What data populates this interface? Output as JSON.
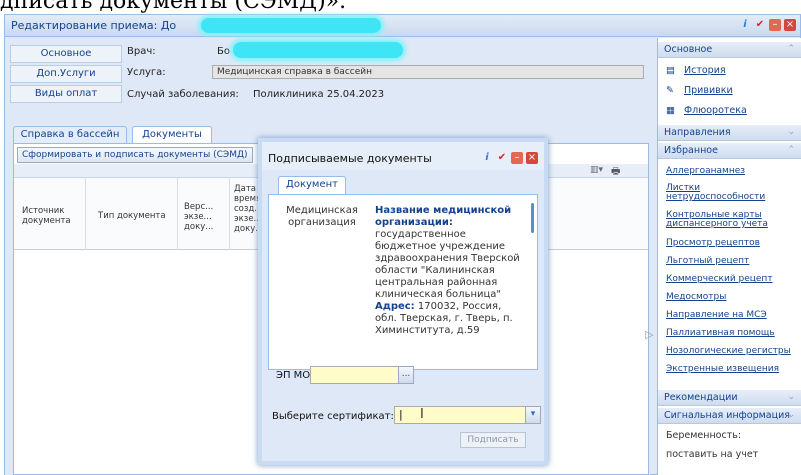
{
  "top_caption": "дписать документы (СЭМД)».",
  "window": {
    "title": "Редактирование приема: До"
  },
  "left_tabs": [
    "Основное",
    "Доп.Услуги",
    "Виды оплат"
  ],
  "form": {
    "doctor_label": "Врач:",
    "doctor_value": "Бо",
    "service_label": "Услуга:",
    "service_value": "Медицинская справка в бассейн",
    "case_label": "Случай заболевания:",
    "case_value": "Поликлиника 25.04.2023"
  },
  "sub_tabs": [
    "Справка в бассейн",
    "Документы"
  ],
  "toolbar": {
    "sign_button": "Сформировать и подписать документы (СЭМД)"
  },
  "grid_columns": [
    "Источник документа",
    "Тип документа",
    "Верс... экзе... доку...",
    "Дата и время созд... экзе... доку..."
  ],
  "dialog": {
    "title": "Подписываемые документы",
    "tab": "Документ",
    "org_label": "Медицинская организация",
    "org_name_label": "Название медицинской организации:",
    "org_name_value": "государственное бюджетное учреждение здравоохранения Тверской области \"Калининская центральная районная клиническая больница\"",
    "address_label": "Адрес:",
    "address_value": "170032, Россия, обл. Тверская, г. Тверь, п. Химинститута, д.59",
    "ep_label": "ЭП МО",
    "ep_trigger": "...",
    "cert_label": "Выберите сертификат:",
    "cert_value": "",
    "sign_button": "Подписать"
  },
  "right_panel": {
    "main_header": "Основное",
    "main_links": [
      {
        "icon": "history-icon",
        "label": "История"
      },
      {
        "icon": "syringe-icon",
        "label": "Прививки"
      },
      {
        "icon": "xray-icon",
        "label": "Флюоротека"
      }
    ],
    "directions_header": "Направления",
    "favorites_header": "Избранное",
    "favorites_links": [
      "Аллергоанамнез",
      "Листки нетрудоспособности",
      "Контрольные карты диспансерного учета",
      "Просмотр рецептов",
      "Льготный рецепт",
      "Коммерческий рецепт",
      "Медосмотры",
      "Направление на МСЭ",
      "Паллиативная помощь",
      "Нозологические регистры",
      "Экстренные извещения"
    ],
    "recommendations_header": "Рекомендации",
    "signal_header": "Сигнальная информация",
    "signal_items": [
      "Беременность:",
      "поставить на учет"
    ]
  }
}
